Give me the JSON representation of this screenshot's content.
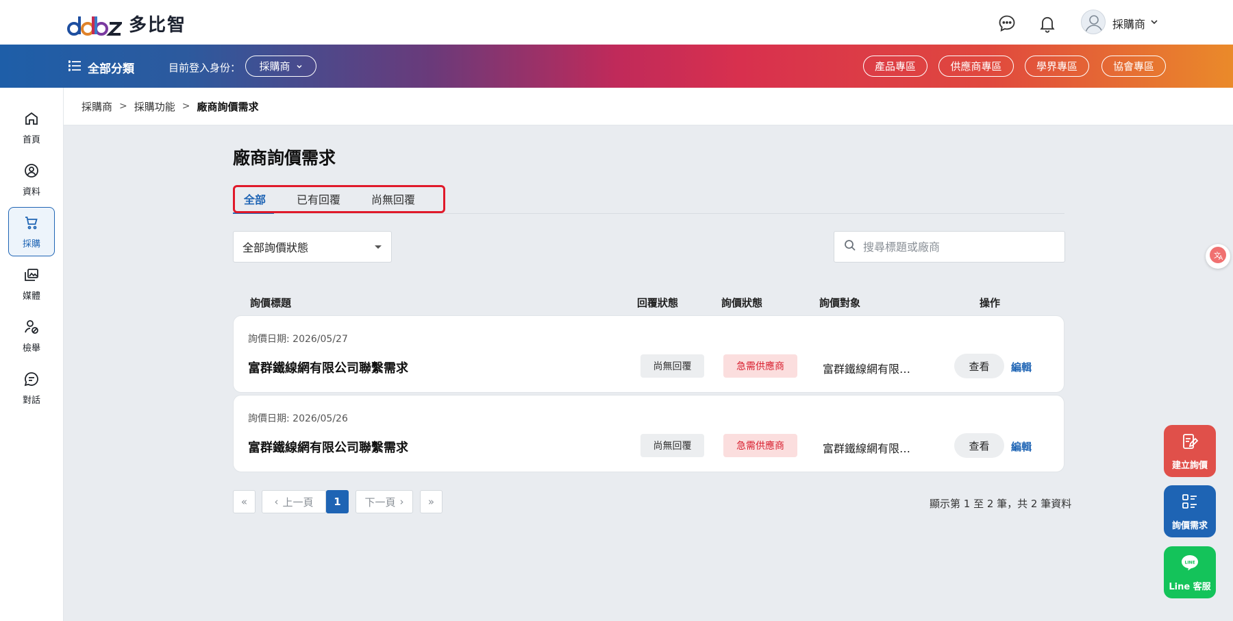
{
  "brand": {
    "name": "多比智"
  },
  "header": {
    "user_name": "採購商",
    "all_categories": "全部分類",
    "role_label": "目前登入身份：",
    "role_value": "採購商",
    "zones": [
      "產品專區",
      "供應商專區",
      "學界專區",
      "協會專區"
    ]
  },
  "sidebar": {
    "items": [
      {
        "label": "首頁",
        "icon": "home-icon"
      },
      {
        "label": "資料",
        "icon": "user-circle-icon"
      },
      {
        "label": "採購",
        "icon": "cart-icon",
        "active": true
      },
      {
        "label": "媒體",
        "icon": "media-icon"
      },
      {
        "label": "檢舉",
        "icon": "report-user-icon"
      },
      {
        "label": "對話",
        "icon": "chat-icon"
      }
    ]
  },
  "breadcrumb": [
    "採購商",
    "採購功能",
    "廠商詢價需求"
  ],
  "main": {
    "title": "廠商詢價需求",
    "tabs": [
      {
        "label": "全部",
        "active": true
      },
      {
        "label": "已有回覆"
      },
      {
        "label": "尚無回覆"
      }
    ],
    "status_filter": "全部詢價狀態",
    "search_placeholder": "搜尋標題或廠商",
    "columns": [
      "詢價標題",
      "回覆狀態",
      "詢價狀態",
      "詢價對象",
      "操作"
    ],
    "rows": [
      {
        "date": "詢價日期: 2026/05/27",
        "title": "富群鐵線網有限公司聯繫需求",
        "reply_status": "尚無回覆",
        "inquiry_status": "急需供應商",
        "target": "富群鐵線網有限…",
        "view": "查看",
        "edit": "編輯"
      },
      {
        "date": "詢價日期: 2026/05/26",
        "title": "富群鐵線網有限公司聯繫需求",
        "reply_status": "尚無回覆",
        "inquiry_status": "急需供應商",
        "target": "富群鐵線網有限…",
        "view": "查看",
        "edit": "編輯"
      }
    ],
    "pagination": {
      "first": "«",
      "prev": "上一頁",
      "current": "1",
      "next": "下一頁",
      "last": "»",
      "summary": "顯示第 1 至 2 筆，共 2 筆資料"
    }
  },
  "floating": {
    "create_inquiry": "建立詢價",
    "inquiry_needs": "詢價需求",
    "line_service": "Line 客服",
    "line_logo_text": "LINE"
  },
  "colors": {
    "primary": "#1e64b4",
    "danger": "#d81e2e",
    "create_fab": "#e0504a",
    "line_green": "#14c35a"
  }
}
